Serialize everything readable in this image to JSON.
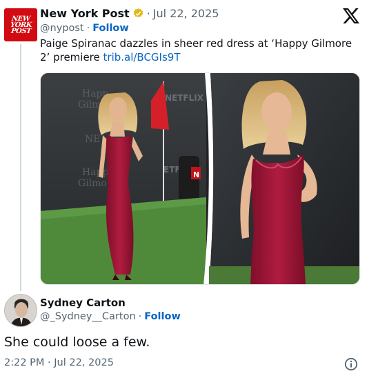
{
  "tweet": {
    "author_name": "New York Post",
    "avatar_text": [
      "NEW",
      "YORK",
      "POST"
    ],
    "date": "Jul 22, 2025",
    "handle": "@nypost",
    "follow_label": "Follow",
    "text": "Paige Spiranac dazzles in sheer red dress at ‘Happy Gilmore 2’ premiere ",
    "link_text": "trib.al/BCGIs9T",
    "separator": "·",
    "media_backdrop": {
      "left_text_1": "Happ",
      "left_text_2": "Gilmo",
      "left_text_3": "NETFLIX",
      "left_text_4": "NE",
      "left_text_5": "Happ",
      "left_text_6": "Gilmo",
      "left_text_7": "ETFLIX",
      "left_text_8": "N"
    }
  },
  "reply": {
    "author_name": "Sydney Carton",
    "handle": "@_Sydney__Carton",
    "follow_label": "Follow",
    "text": "She could loose a few.",
    "timestamp": "2:22 PM · Jul 22, 2025"
  },
  "colors": {
    "brand_red": "#d20a11",
    "link_blue": "#0a66c2",
    "muted": "#536471",
    "verified_gold": "#e2b719",
    "dress_red": "#9a1535",
    "carpet_green": "#4f8a3a"
  },
  "icons": [
    "verified-badge-icon",
    "x-logo-icon",
    "info-icon"
  ]
}
